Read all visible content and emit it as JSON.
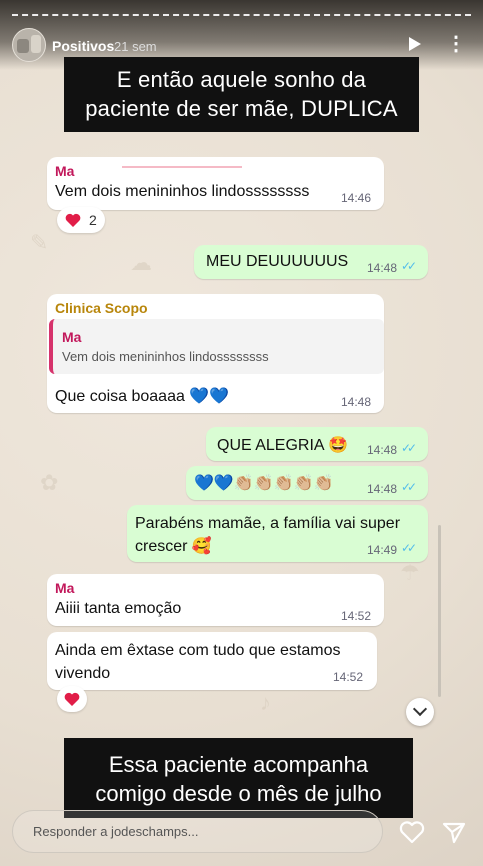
{
  "header": {
    "username": "Positivos",
    "time_ago": "21 sem",
    "play_icon": "play-icon",
    "more_icon": "more-icon"
  },
  "captions": {
    "top": [
      "E então aquele sonho da",
      "paciente de ser mãe, DUPLICA"
    ],
    "bottom": [
      "Essa paciente acompanha",
      "comigo desde o mês de julho"
    ]
  },
  "messages": [
    {
      "id": "m1",
      "dir": "in",
      "sender": "Ma",
      "text": "Vem dois menininhos lindossssssss",
      "time": "14:46",
      "reaction": "2"
    },
    {
      "id": "m2",
      "dir": "out",
      "text": "MEU DEUUUUUUS",
      "time": "14:48"
    },
    {
      "id": "m3",
      "dir": "in",
      "sender": "Clinica Scopo",
      "quote_sender": "Ma",
      "quote_text": "Vem dois menininhos lindossssssss",
      "text": "Que coisa boaaaa 💙💙",
      "time": "14:48"
    },
    {
      "id": "m4",
      "dir": "out",
      "text": "QUE ALEGRIA 🤩",
      "time": "14:48"
    },
    {
      "id": "m5",
      "dir": "out",
      "text": "💙💙👏🏼👏🏼👏🏼👏🏼👏🏼",
      "time": "14:48"
    },
    {
      "id": "m6",
      "dir": "out",
      "text": [
        "Parabéns mamãe, a família vai super",
        "crescer 🥰"
      ],
      "time": "14:49"
    },
    {
      "id": "m7",
      "dir": "in",
      "sender": "Ma",
      "text": "Aiiii tanta emoção",
      "time": "14:52"
    },
    {
      "id": "m8",
      "dir": "in",
      "text": [
        "Ainda em êxtase com tudo que estamos",
        "vivendo"
      ],
      "time": "14:52"
    }
  ],
  "reply": {
    "placeholder": "Responder a jodeschamps..."
  },
  "colors": {
    "outgoing_bubble": "#d9fdd3",
    "incoming_bubble": "#ffffff",
    "sender_pink": "#c2185b",
    "sender_clinic": "#b8860b",
    "tick_blue": "#53bdeb",
    "heart_red": "#e11d48"
  }
}
